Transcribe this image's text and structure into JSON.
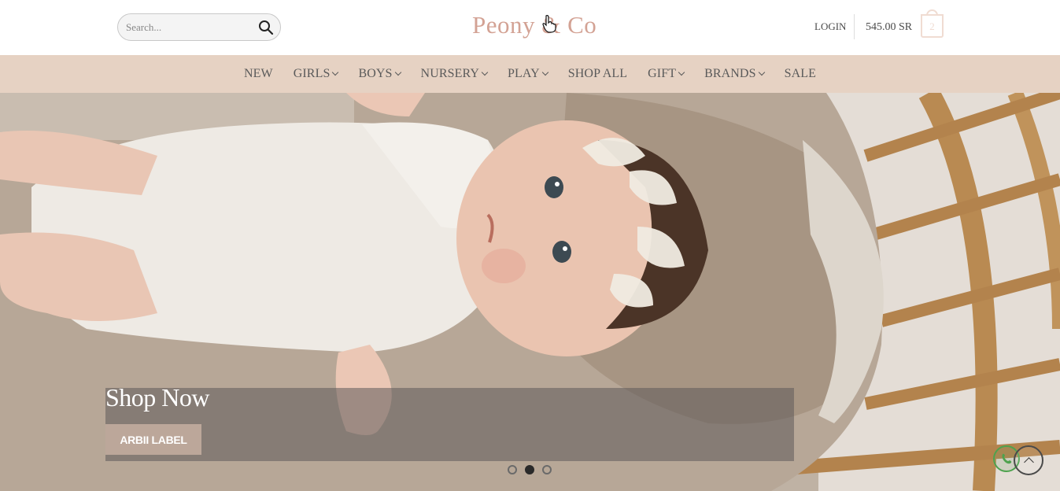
{
  "header": {
    "search_placeholder": "Search...",
    "logo_text": "Peony & Co",
    "login_label": "LOGIN",
    "cart_total": "545.00 SR",
    "cart_count": "2"
  },
  "nav": {
    "items": [
      {
        "label": "NEW",
        "has_dropdown": false
      },
      {
        "label": "GIRLS",
        "has_dropdown": true
      },
      {
        "label": "BOYS",
        "has_dropdown": true
      },
      {
        "label": "NURSERY",
        "has_dropdown": true
      },
      {
        "label": "PLAY",
        "has_dropdown": true
      },
      {
        "label": "SHOP ALL",
        "has_dropdown": false
      },
      {
        "label": "GIFT",
        "has_dropdown": true
      },
      {
        "label": "BRANDS",
        "has_dropdown": true
      },
      {
        "label": "SALE",
        "has_dropdown": false
      }
    ]
  },
  "hero": {
    "caption_title": "Shop Now",
    "button_label": "ARBII LABEL",
    "slide_count": 3,
    "active_slide": 2
  },
  "colors": {
    "logo": "#d3a294",
    "nav_bg": "#e6d2c3",
    "button_bg": "#bca79a"
  }
}
